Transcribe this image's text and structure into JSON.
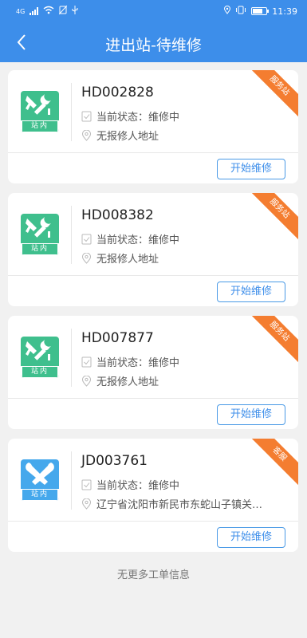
{
  "status_bar": {
    "network": "4G",
    "time": "11:39",
    "icons": [
      "signal-icon",
      "wifi-icon",
      "no-sim-icon",
      "usb-icon",
      "location-icon",
      "vibrate-icon",
      "battery-icon"
    ]
  },
  "header": {
    "back_icon": "chevron-left-icon",
    "title": "进出站-待维修"
  },
  "labels": {
    "status_prefix": "当前状态：",
    "action_button": "开始维修"
  },
  "colors": {
    "header": "#3d8eea",
    "ribbon": "#f47d30",
    "icon_green": "#3fbf8d",
    "icon_blue": "#45a8ec"
  },
  "orders": [
    {
      "id": "HD002828",
      "status": "维修中",
      "address": "无报修人地址",
      "tag": "站内",
      "ribbon": "服务站",
      "icon": "repair-station-icon"
    },
    {
      "id": "HD008382",
      "status": "维修中",
      "address": "无报修人地址",
      "tag": "站内",
      "ribbon": "服务站",
      "icon": "repair-station-icon"
    },
    {
      "id": "HD007877",
      "status": "维修中",
      "address": "无报修人地址",
      "tag": "站内",
      "ribbon": "服务站",
      "icon": "repair-station-icon"
    },
    {
      "id": "JD003761",
      "status": "维修中",
      "address": "辽宁省沈阳市新民市东蛇山子镇关家...",
      "tag": "站内",
      "ribbon": "客服",
      "icon": "tools-icon"
    }
  ],
  "footer": {
    "text": "无更多工单信息"
  }
}
